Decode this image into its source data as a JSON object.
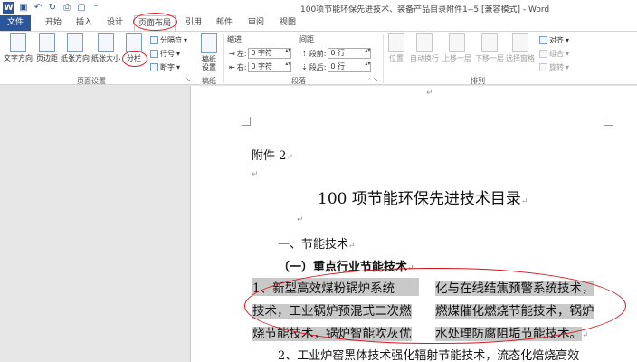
{
  "window": {
    "title": "100项节能环保先进技术、装备产品目录附件1--5 [兼容模式] - Word"
  },
  "tabs": [
    "文件",
    "开始",
    "插入",
    "设计",
    "页面布局",
    "引用",
    "邮件",
    "审阅",
    "视图"
  ],
  "ribbon": {
    "page_setup": {
      "group_label": "页面设置",
      "text_direction": "文字方向",
      "margins": "页边距",
      "orientation": "纸张方向",
      "size": "纸张大小",
      "columns": "分栏",
      "breaks": "分隔符",
      "line_numbers": "行号",
      "hyphenation": "断字"
    },
    "draft": {
      "group_label": "稿纸",
      "label_line1": "稿纸",
      "label_line2": "设置"
    },
    "paragraph": {
      "group_label": "段落",
      "indent_title": "缩进",
      "spacing_title": "间距",
      "left_label": "左:",
      "right_label": "右:",
      "left_value": "0 字符",
      "right_value": "0 字符",
      "before_label": "段前:",
      "after_label": "段后:",
      "before_value": "0 行",
      "after_value": "0 行"
    },
    "arrange": {
      "group_label": "排列",
      "position": "位置",
      "wrap_text": "自动换行",
      "bring_forward": "上移一层",
      "send_backward": "下移一层",
      "selection_pane": "选择窗格",
      "align": "对齐",
      "group": "组合",
      "rotate": "旋转"
    }
  },
  "document": {
    "attachment": "附件 2",
    "title": "100 项节能环保先进技术目录",
    "section1": "一、节能技术",
    "subsection1": "（一）重点行业节能技术",
    "col1": [
      "1、新型高效煤粉锅炉系统",
      "技术，工业锅炉预混式二次燃",
      "烧节能技术，锅炉智能吹灰优"
    ],
    "col2": [
      "化与在线结焦预警系统技术，",
      "燃煤催化燃烧节能技术，锅炉",
      "水处理防腐阻垢节能技术。"
    ],
    "item2": "2、工业炉窑黑体技术强化辐射节能技术，流态化焙烧高效"
  }
}
